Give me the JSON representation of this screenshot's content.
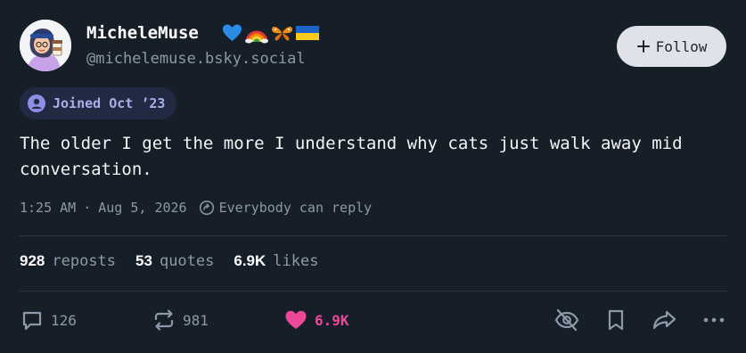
{
  "author": {
    "display_name": "MicheleMuse",
    "handle": "@michelemuse.bsky.social",
    "flag_icons": [
      "blue-heart-icon",
      "rainbow-icon",
      "butterfly-icon",
      "ukraine-flag-icon"
    ]
  },
  "follow_label": "Follow",
  "joined_label": "Joined Oct ’23",
  "post": {
    "text": "The older I get the more I understand why cats just walk away mid conversation.",
    "time": "1:25 AM",
    "separator": "·",
    "date": "Aug 5, 2026",
    "reply_setting": "Everybody can reply"
  },
  "stats": {
    "reposts_count": "928",
    "reposts_label": "reposts",
    "quotes_count": "53",
    "quotes_label": "quotes",
    "likes_count": "6.9K",
    "likes_label": "likes"
  },
  "actions": {
    "reply_count": "126",
    "repost_count": "981",
    "like_count": "6.9K"
  },
  "colors": {
    "background": "#161e27",
    "like_accent": "#ec4899",
    "muted_text": "#8d99a8",
    "follow_button": "#dfe2e9",
    "badge_bg": "#222a43"
  }
}
